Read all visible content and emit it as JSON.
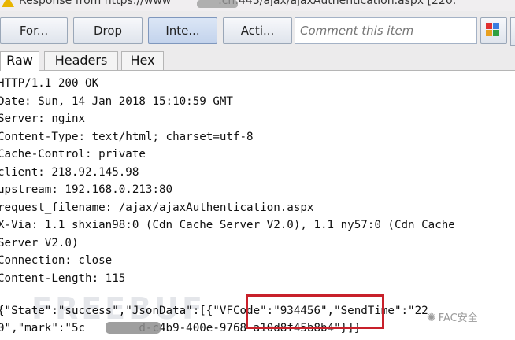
{
  "window": {
    "title": "Response from https://www",
    "title_suffix": ".cn:443/ajax/ajaxAuthentication.aspx  [220."
  },
  "toolbar": {
    "forward_label": "For...",
    "drop_label": "Drop",
    "intercept_label": "Inte...",
    "action_label": "Acti...",
    "comment_placeholder": "Comment this item"
  },
  "tabs": [
    "Raw",
    "Headers",
    "Hex"
  ],
  "response": {
    "lines": [
      "HTTP/1.1 200 OK",
      "Date: Sun, 14 Jan 2018 15:10:59 GMT",
      "Server: nginx",
      "Content-Type: text/html; charset=utf-8",
      "Cache-Control: private",
      "client: 218.92.145.98",
      "upstream: 192.168.0.213:80",
      "request_filename: /ajax/ajaxAuthentication.aspx",
      "X-Via: 1.1 shxian98:0 (Cdn Cache Server V2.0), 1.1 ny57:0 (Cdn Cache",
      "Server V2.0)",
      "Connection: close",
      "Content-Length: 115"
    ],
    "json_line_1": "{\"State\":\"success\",\"JsonData\":[{\"VFCode\":\"934456\",\"SendTime\":\"22",
    "json_line_2": "0\",\"mark\":\"5c        d-c4b9-400e-9768-a10d8f45b8b4\"}]}"
  },
  "watermark": {
    "text": "FAC安全",
    "bg_text": "FREEBUF"
  },
  "colors": {
    "highlight": "#c8202a",
    "toolbar_bg": "#ecebec"
  }
}
